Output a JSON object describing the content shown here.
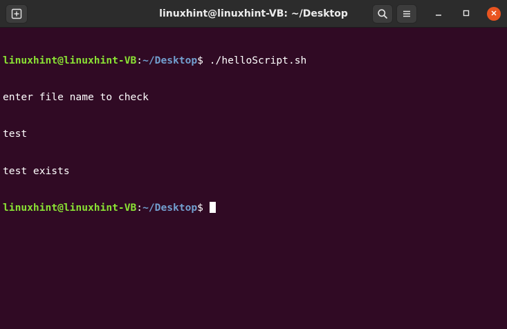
{
  "window": {
    "title": "linuxhint@linuxhint-VB: ~/Desktop"
  },
  "titlebar": {
    "icons": {
      "new_tab": "new-tab-icon",
      "search": "search-icon",
      "menu": "hamburger-menu-icon",
      "minimize": "minimize-icon",
      "maximize": "maximize-icon",
      "close": "close-icon"
    }
  },
  "terminal": {
    "prompt_user_host": "linuxhint@linuxhint-VB",
    "prompt_colon": ":",
    "prompt_path": "~/Desktop",
    "prompt_symbol": "$ ",
    "command": "./helloScript.sh",
    "output": [
      "enter file name to check",
      "test",
      "test exists"
    ]
  },
  "colors": {
    "background": "#300a24",
    "titlebar": "#2c2c2c",
    "prompt_user": "#8ae234",
    "prompt_path": "#729fcf",
    "text": "#ffffff",
    "close_button": "#e95420"
  }
}
